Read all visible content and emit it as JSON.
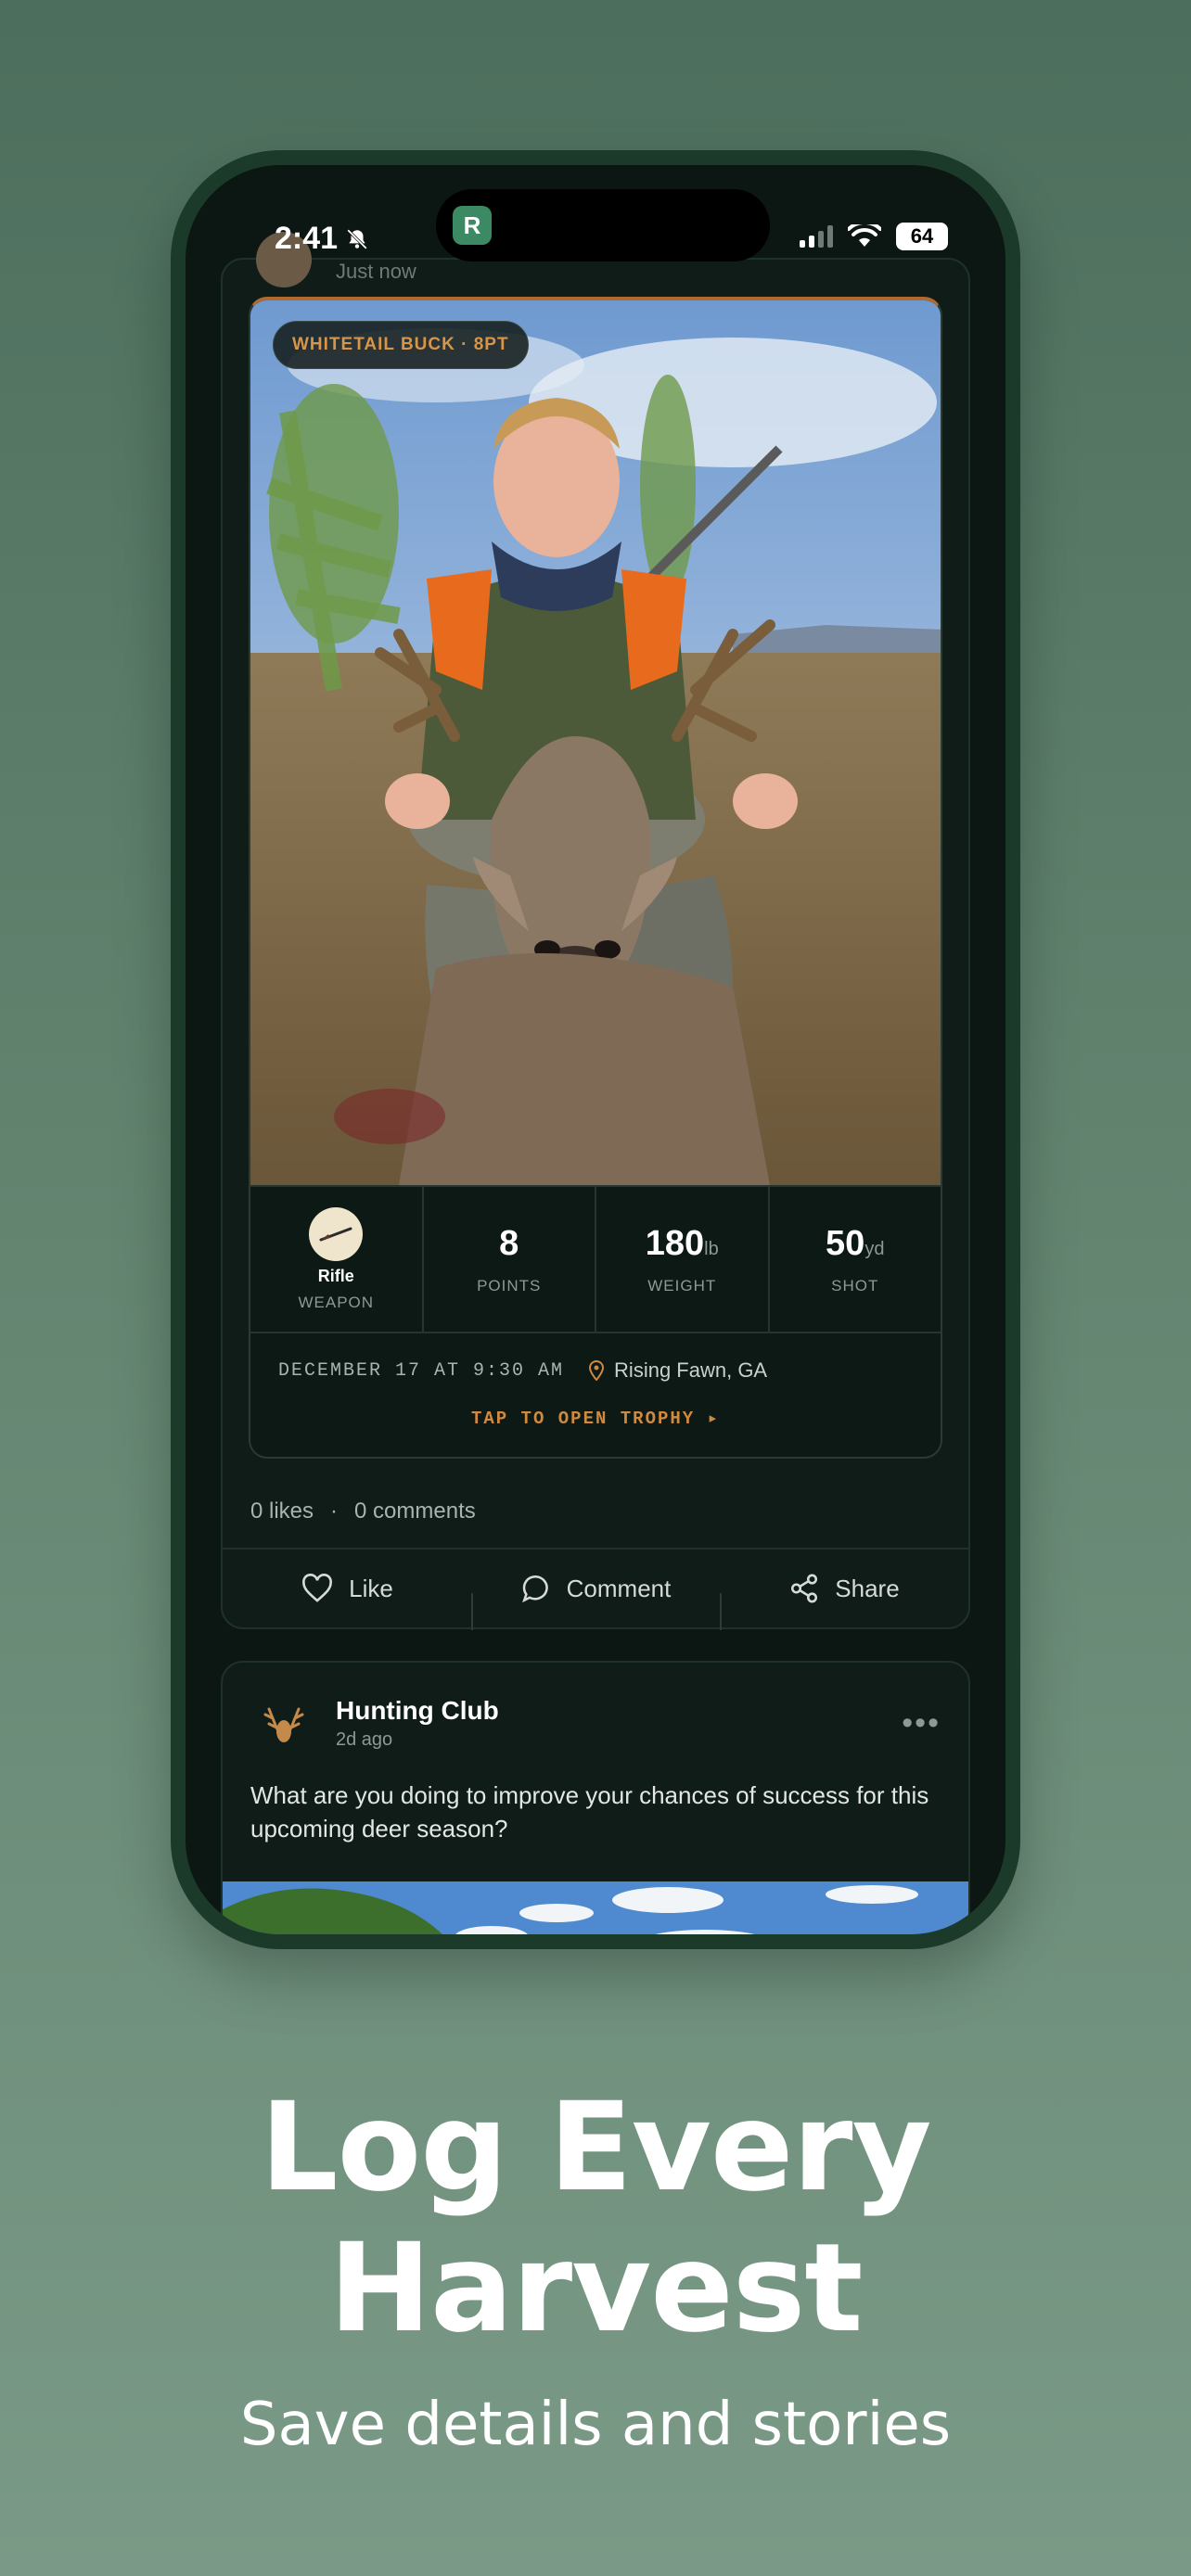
{
  "status_bar": {
    "time": "2:41",
    "battery": "64",
    "island_app_letter": "R"
  },
  "post": {
    "header_time": "Just now",
    "badge": "WHITETAIL BUCK · 8PT",
    "stats": {
      "weapon_name": "Rifle",
      "weapon_label": "WEAPON",
      "points_value": "8",
      "points_label": "POINTS",
      "weight_value": "180",
      "weight_unit": "lb",
      "weight_label": "WEIGHT",
      "shot_value": "50",
      "shot_unit": "yd",
      "shot_label": "SHOT"
    },
    "date": "DECEMBER 17 AT 9:30 AM",
    "location": "Rising Fawn, GA",
    "open_trophy": "TAP TO OPEN TROPHY ▸",
    "likes": "0 likes",
    "separator": "·",
    "comments": "0 comments",
    "actions": {
      "like": "Like",
      "comment": "Comment",
      "share": "Share"
    }
  },
  "post2": {
    "author": "Hunting Club",
    "time": "2d ago",
    "more": "•••",
    "text": "What are you doing to improve your chances of success for this upcoming deer season?"
  },
  "marketing": {
    "headline_line1": "Log Every",
    "headline_line2": "Harvest",
    "subhead": "Save details and stories"
  },
  "colors": {
    "accent": "#d08a40",
    "background": "#5b7d69",
    "phone_frame": "#1c3a2a"
  }
}
